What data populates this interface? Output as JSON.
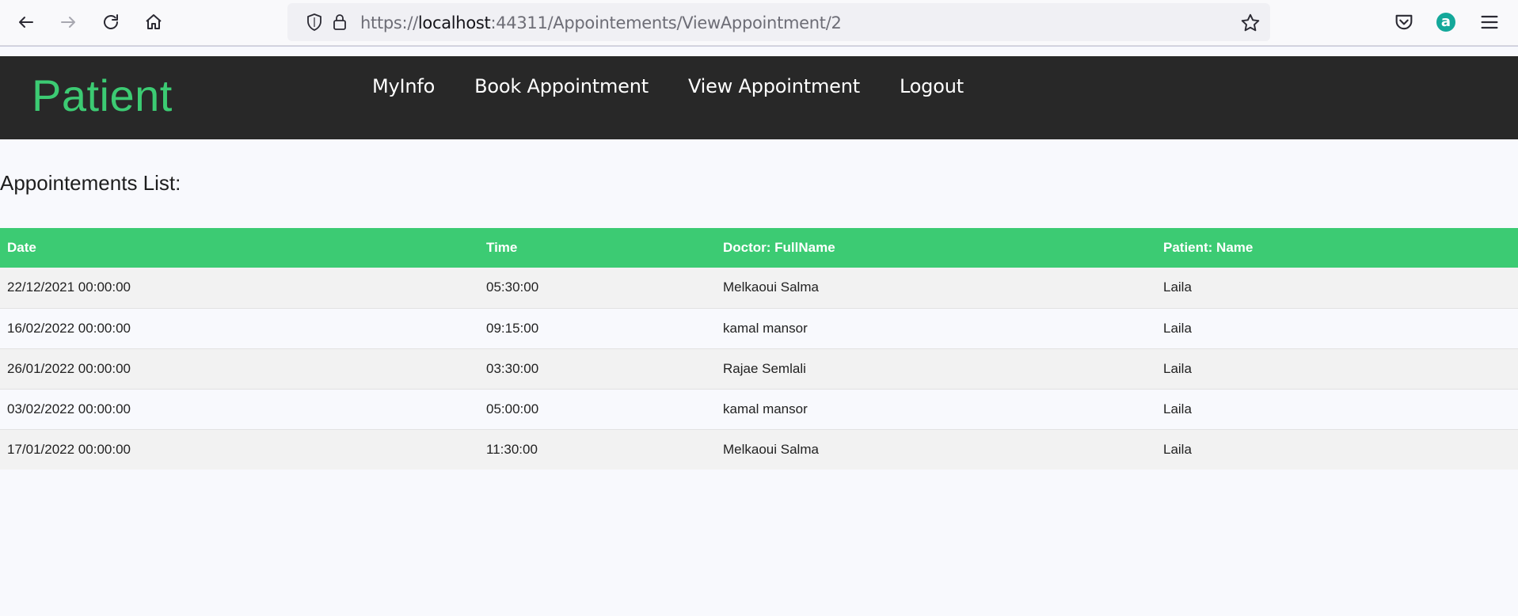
{
  "browser": {
    "url_prefix": "https://",
    "url_host": "localhost",
    "url_rest": ":44311/Appointements/ViewAppointment/2",
    "account_letter": "a"
  },
  "site": {
    "brand": "Patient",
    "brand_color": "#3ccb73",
    "nav": [
      {
        "label": "MyInfo"
      },
      {
        "label": "Book Appointment"
      },
      {
        "label": "View Appointment"
      },
      {
        "label": "Logout"
      }
    ]
  },
  "page": {
    "title": "Appointements List:"
  },
  "table": {
    "headers": [
      "Date",
      "Time",
      "Doctor: FullName",
      "Patient: Name"
    ],
    "rows": [
      [
        "22/12/2021 00:00:00",
        "05:30:00",
        "Melkaoui Salma",
        "Laila"
      ],
      [
        "16/02/2022 00:00:00",
        "09:15:00",
        "kamal mansor",
        "Laila"
      ],
      [
        "26/01/2022 00:00:00",
        "03:30:00",
        "Rajae Semlali",
        "Laila"
      ],
      [
        "03/02/2022 00:00:00",
        "05:00:00",
        "kamal mansor",
        "Laila"
      ],
      [
        "17/01/2022 00:00:00",
        "11:30:00",
        "Melkaoui Salma",
        "Laila"
      ]
    ]
  }
}
